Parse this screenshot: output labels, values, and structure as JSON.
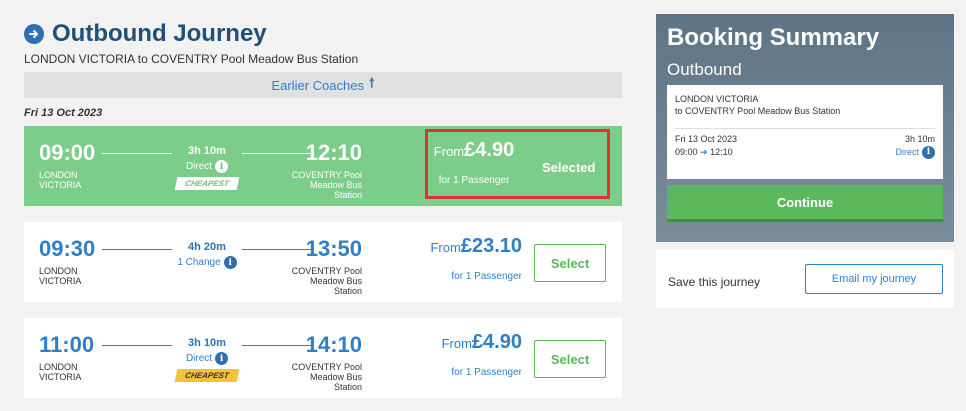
{
  "header": {
    "title": "Outbound Journey",
    "route": "LONDON VICTORIA to COVENTRY Pool Meadow Bus Station"
  },
  "earlier": {
    "label": "Earlier Coaches",
    "icon": "arrow-up-icon"
  },
  "date": "Fri 13 Oct 2023",
  "journeys": [
    {
      "dep_time": "09:00",
      "dep_place_1": "LONDON",
      "dep_place_2": "VICTORIA",
      "duration": "3h 10m",
      "changes": "Direct",
      "badge": "CHEAPEST",
      "arr_time": "12:10",
      "arr_place_1": "COVENTRY Pool",
      "arr_place_2": "Meadow Bus",
      "arr_place_3": "Station",
      "from": "From",
      "price": "£4.90",
      "pax": "for 1 Passenger",
      "action": "Selected"
    },
    {
      "dep_time": "09:30",
      "dep_place_1": "LONDON",
      "dep_place_2": "VICTORIA",
      "duration": "4h 20m",
      "changes": "1 Change",
      "arr_time": "13:50",
      "arr_place_1": "COVENTRY Pool",
      "arr_place_2": "Meadow Bus",
      "arr_place_3": "Station",
      "from": "From",
      "price": "£23.10",
      "pax": "for 1 Passenger",
      "action": "Select"
    },
    {
      "dep_time": "11:00",
      "dep_place_1": "LONDON",
      "dep_place_2": "VICTORIA",
      "duration": "3h 10m",
      "changes": "Direct",
      "badge": "CHEAPEST",
      "arr_time": "14:10",
      "arr_place_1": "COVENTRY Pool",
      "arr_place_2": "Meadow Bus",
      "arr_place_3": "Station",
      "from": "From",
      "price": "£4.90",
      "pax": "for 1 Passenger",
      "action": "Select"
    }
  ],
  "summary": {
    "title": "Booking Summary",
    "direction": "Outbound",
    "from": "LONDON VICTORIA",
    "to": "to COVENTRY Pool Meadow Bus Station",
    "date": "Fri 13 Oct 2023",
    "duration": "3h 10m",
    "dep": "09:00",
    "arr": "12:10",
    "changes": "Direct",
    "continue": "Continue"
  },
  "save": {
    "label": "Save this journey",
    "button": "Email my journey"
  },
  "colors": {
    "selected_bg": "#7ccd8a",
    "accent_blue": "#2f7fc8",
    "button_green": "#5cb85c",
    "badge_yellow": "#f3c23c",
    "highlight_red": "#d33333"
  }
}
